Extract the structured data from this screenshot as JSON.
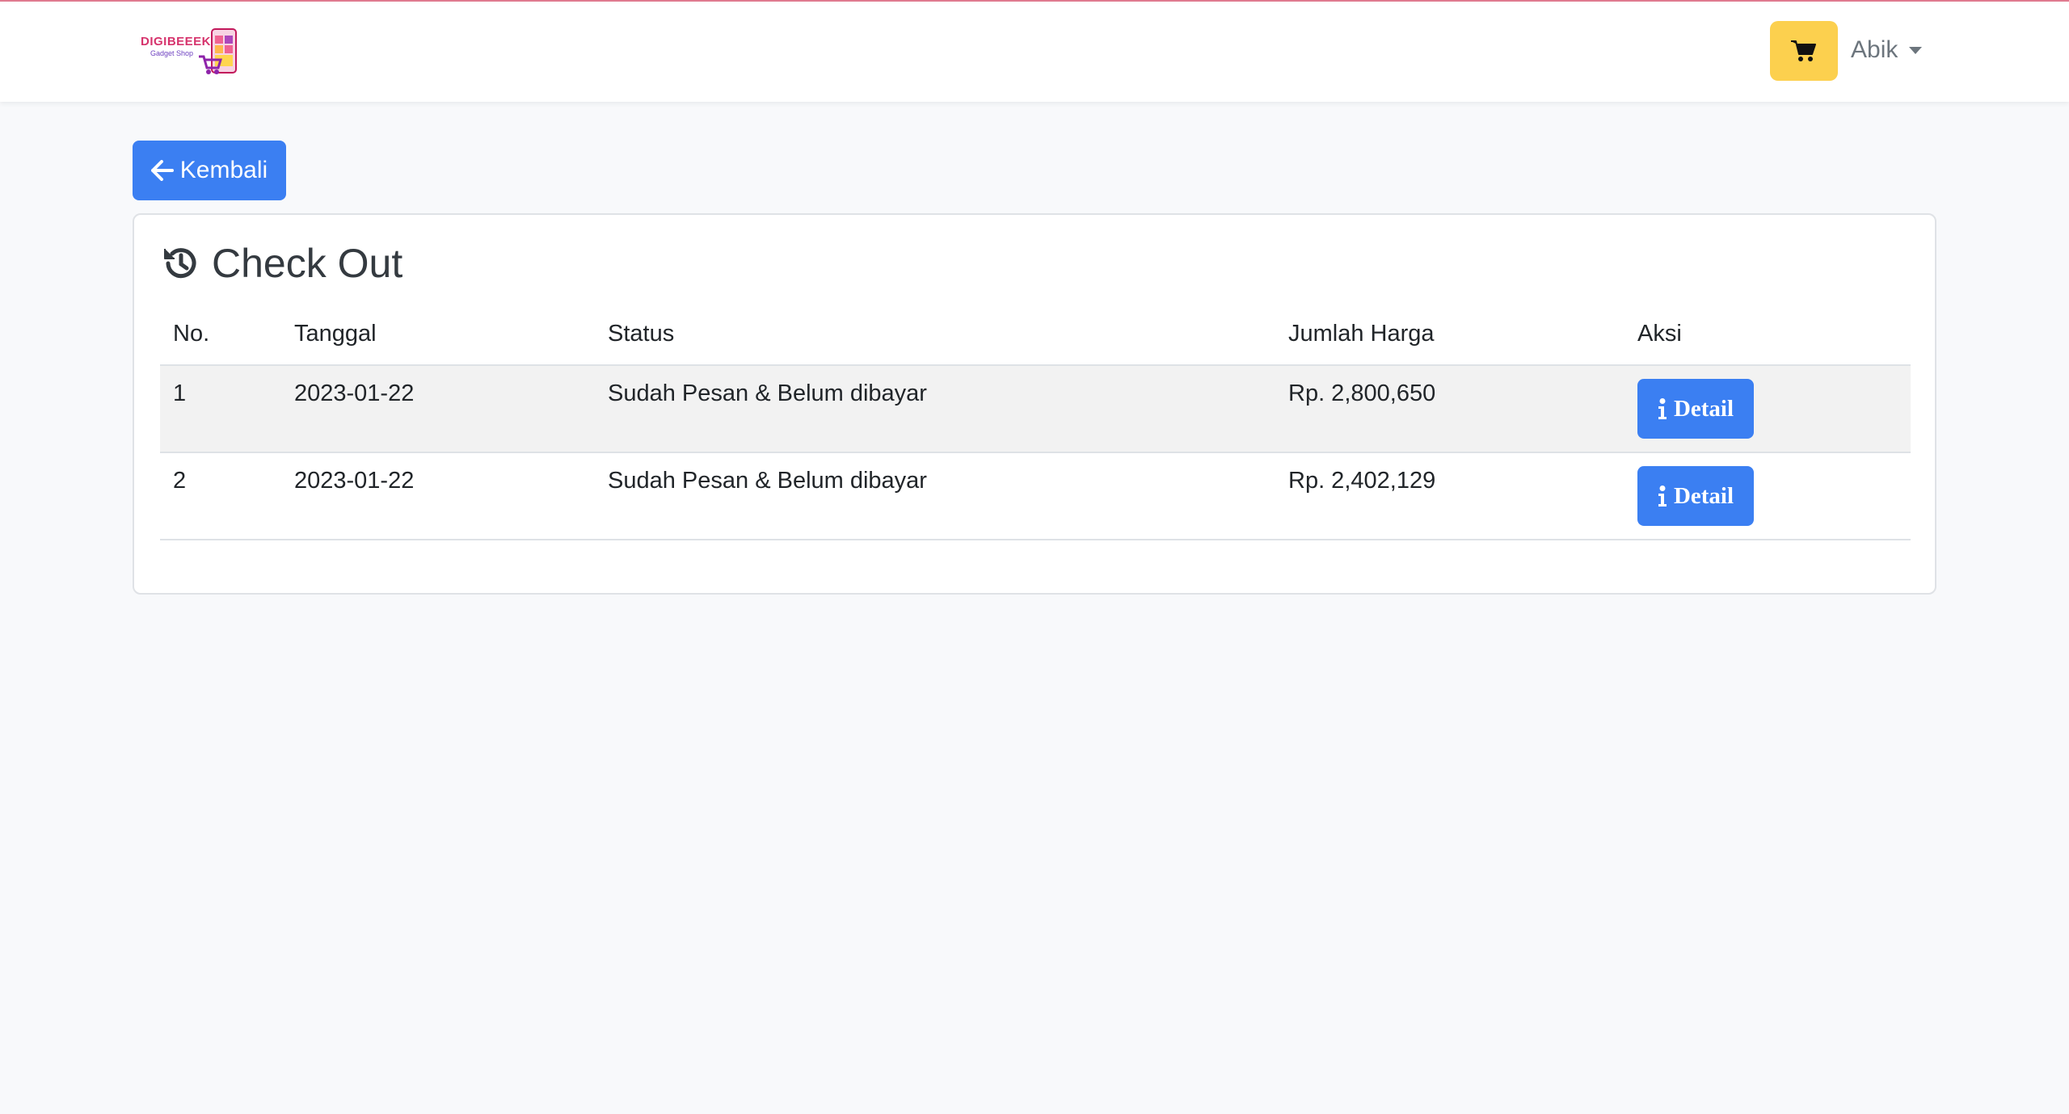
{
  "brand": {
    "name": "DIGIBEEEK",
    "sub": "Gadget Shop",
    "logo_icon": "phone-cart-logo"
  },
  "nav": {
    "cart_icon": "shopping-cart-icon",
    "user_name": "Abik",
    "accent_cart": "#fcd04e"
  },
  "back_button": {
    "label": "Kembali",
    "icon": "arrow-left-icon"
  },
  "card": {
    "title": "Check Out",
    "title_icon": "history-icon"
  },
  "table": {
    "headers": [
      "No.",
      "Tanggal",
      "Status",
      "Jumlah Harga",
      "Aksi"
    ],
    "rows": [
      {
        "no": "1",
        "date": "2023-01-22",
        "status": "Sudah Pesan & Belum dibayar",
        "total": "Rp. 2,800,650",
        "action": "Detail"
      },
      {
        "no": "2",
        "date": "2023-01-22",
        "status": "Sudah Pesan & Belum dibayar",
        "total": "Rp. 2,402,129",
        "action": "Detail"
      }
    ]
  },
  "colors": {
    "primary": "#3b7ff2",
    "warning": "#fcd04e"
  }
}
